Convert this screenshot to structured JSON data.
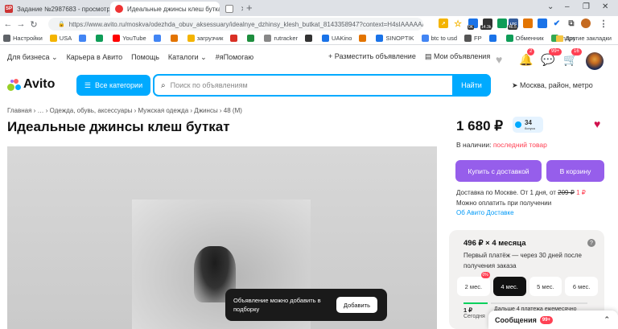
{
  "browser": {
    "tabs": [
      {
        "label": "Задание №2987683 - просмотр з",
        "favicon": "SP"
      },
      {
        "label": "Идеальные джинсы клеш буткат",
        "favicon": "avito"
      },
      {
        "label": "",
        "favicon": "image"
      }
    ],
    "new_tab": "+",
    "url": "https://www.avito.ru/moskva/odezhda_obuv_aksessuary/idealnye_dzhinsy_klesh_butkat_8143358947?context=H4sIAAAAAAA_w...",
    "window_controls": [
      "⌄",
      "–",
      "❐",
      "✕"
    ],
    "extension_badges": {
      "b1": "0K",
      "b2": "14.3k",
      "ltc": "LTC",
      "ltc_val": "46.5"
    }
  },
  "bookmarks": [
    {
      "label": "Настройки",
      "color": "#5f6368"
    },
    {
      "label": "USA",
      "color": "#f4b400"
    },
    {
      "label": "",
      "color": "#4285f4"
    },
    {
      "label": "",
      "color": "#0f9d58"
    },
    {
      "label": "YouTube",
      "color": "#ff0000"
    },
    {
      "label": "",
      "color": "#4285f4"
    },
    {
      "label": "",
      "color": "#e37400"
    },
    {
      "label": "загрузчик",
      "color": "#f4b400"
    },
    {
      "label": "",
      "color": "#d93025"
    },
    {
      "label": "",
      "color": "#1e8e3e"
    },
    {
      "label": "rutracker",
      "color": "#888888"
    },
    {
      "label": "",
      "color": "#333333"
    },
    {
      "label": "UAKino",
      "color": "#1a73e8"
    },
    {
      "label": "",
      "color": "#e37400"
    },
    {
      "label": "SINOPTIK",
      "color": "#1a73e8"
    },
    {
      "label": "btc to usd",
      "color": "#4285f4"
    },
    {
      "label": "FP",
      "color": "#555555"
    },
    {
      "label": "",
      "color": "#1a73e8"
    },
    {
      "label": "Обменник",
      "color": "#0f9d58"
    },
    {
      "label": "maps",
      "color": "#34a853"
    }
  ],
  "bookmarks_other": "Другие закладки",
  "topnav": {
    "links": [
      "Для бизнеса ⌄",
      "Карьера в Авито",
      "Помощь",
      "Каталоги ⌄",
      "#яПомогаю"
    ],
    "post_ad": "+ Разместить объявление",
    "my_ads": "Мои объявления",
    "counts": {
      "favorites": "",
      "notifications": "2",
      "messages": "99+",
      "cart": "16"
    }
  },
  "search": {
    "logo": "Avito",
    "categories_button": "Все категории",
    "placeholder": "Поиск по объявлениям",
    "button": "Найти",
    "location": "Москва, район, метро"
  },
  "listing": {
    "breadcrumbs": "Главная › … › Одежда, обувь, аксессуары › Мужская одежда › Джинсы › 48 (M)",
    "title": "Идеальные джинсы клеш буткат",
    "toast": {
      "text": "Объявление можно добавить в подборку",
      "button": "Добавить"
    }
  },
  "sidebar": {
    "price": "1 680 ₽",
    "rating_value": "34",
    "rating_label": "бонуса",
    "stock_prefix": "В наличии:",
    "stock_status": "последний товар",
    "buy_button": "Купить с доставкой",
    "cart_button": "В корзину",
    "delivery_line1_prefix": "Доставка по Москве. От 1 дня, от",
    "delivery_old_price": "209 ₽",
    "delivery_new_price": "1 ₽",
    "delivery_line2": "Можно оплатить при получении",
    "delivery_link": "Об Авито Доставке",
    "installment": {
      "header": "496 ₽ × 4 месяца",
      "help": "?",
      "desc": "Первый платёж — через 30 дней после получения заказа",
      "terms": [
        {
          "label": "2 мес.",
          "badge": "0%"
        },
        {
          "label": "4 мес.",
          "badge": ""
        },
        {
          "label": "5 мес.",
          "badge": ""
        },
        {
          "label": "6 мес.",
          "badge": ""
        }
      ],
      "selected_term": "4 мес.",
      "first_amount": "1 ₽",
      "first_when": "Сегодня",
      "next_note": "Дальше 4 платежа ежемесячно"
    }
  },
  "messages": {
    "label": "Сообщения",
    "count": "99+"
  },
  "colors": {
    "accent": "#00aaff",
    "buy": "#965eeb",
    "badge": "#ff4053",
    "heart": "#d0104c"
  }
}
